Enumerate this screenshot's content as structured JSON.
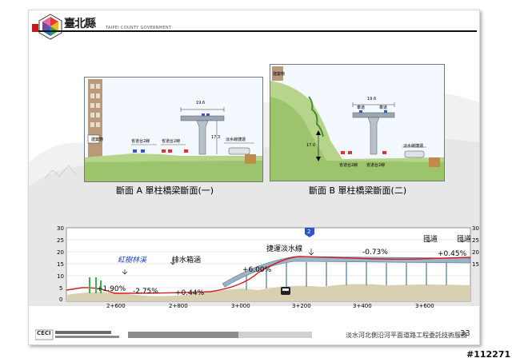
{
  "header": {
    "logo_script": "臺北縣",
    "gov_text": "TAIPEI COUNTY GOVERNMENT"
  },
  "panel_a": {
    "caption": "斷面 A 單柱橋梁斷面(一)",
    "building_label": "建築物",
    "width_top": "19.6",
    "label_left": "省道台2線",
    "label_mid": "省道台2線",
    "label_right": "淡水線捷運",
    "pier_height": "17.3"
  },
  "panel_b": {
    "caption": "斷面 B 單柱橋梁斷面(二)",
    "building_label": "建築物",
    "width_top": "19.6",
    "lane_label_1": "車道",
    "lane_label_2": "車道",
    "height_label": "17.0",
    "label_left": "省道台2線",
    "label_mid": "省道台2線",
    "label_right": "淡水線捷運"
  },
  "profile": {
    "y_ticks": [
      "30",
      "25",
      "20",
      "15",
      "10",
      "5",
      "0"
    ],
    "stations": [
      "2+600",
      "2+800",
      "3+000",
      "3+200",
      "3+400",
      "3+600"
    ],
    "features": [
      {
        "text": "紅樹林溪",
        "color": "#1a3cc4"
      },
      {
        "text": "排水箱涵",
        "color": "#000000"
      },
      {
        "text": "捷運淡水線",
        "color": "#000000"
      },
      {
        "text": "匝道",
        "color": "#000000"
      },
      {
        "text": "匝道",
        "color": "#000000"
      }
    ],
    "grades": [
      "+1.90%",
      "-2.75%",
      "+0.44%",
      "+6.00%",
      "-0.73%",
      "+0.45%"
    ],
    "marker": "2"
  },
  "footer": {
    "org_text": "CECI",
    "project_title": "淡水河北側沿河平面道路工程委託技術服務",
    "page_number": "33"
  },
  "stamp": "#112271"
}
